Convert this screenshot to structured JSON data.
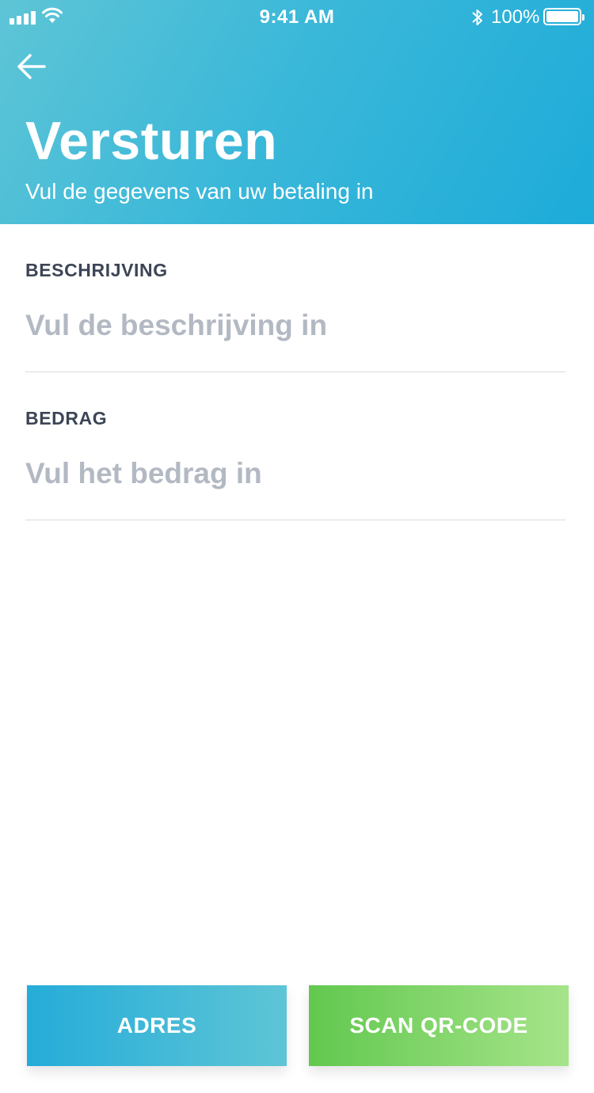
{
  "status_bar": {
    "time": "9:41 AM",
    "battery_percent": "100%",
    "battery_level": 1.0,
    "icons": [
      "signal-icon",
      "wifi-icon",
      "bluetooth-icon",
      "battery-icon"
    ]
  },
  "header": {
    "back_icon": "arrow-left-icon",
    "title": "Versturen",
    "subtitle": "Vul de gegevens van uw betaling in"
  },
  "form": {
    "description": {
      "label": "BESCHRIJVING",
      "value": "",
      "placeholder": "Vul de beschrijving in"
    },
    "amount": {
      "label": "BEDRAG",
      "value": "",
      "placeholder": "Vul het bedrag in"
    }
  },
  "actions": {
    "address_label": "ADRES",
    "scan_label": "SCAN QR-CODE"
  },
  "colors": {
    "header_gradient_start": "#5ec5d6",
    "header_gradient_end": "#1dabd9",
    "label_text": "#3c4556",
    "placeholder_text": "#b3b9c3",
    "divider": "#d7dbe0",
    "adres_gradient_start": "#25acd9",
    "adres_gradient_end": "#5ec5d6",
    "scan_gradient_start": "#62c84f",
    "scan_gradient_end": "#a6e48a"
  }
}
